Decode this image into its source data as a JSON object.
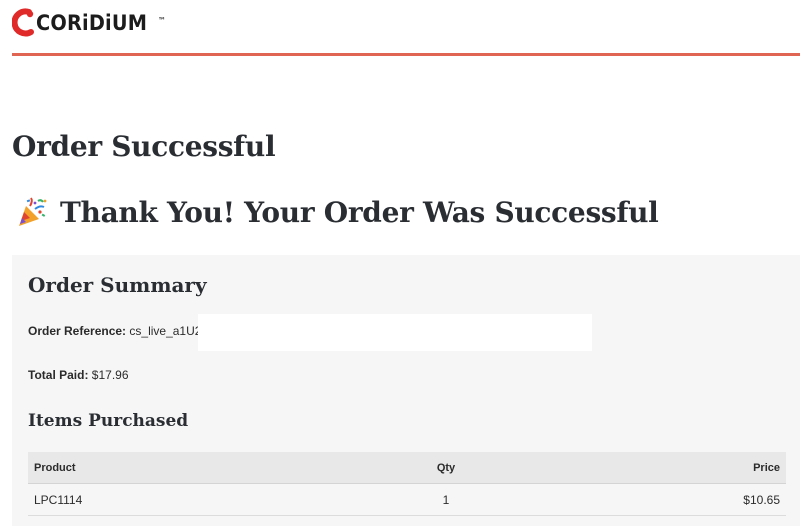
{
  "header": {
    "logo_text": "CORiDiUM",
    "logo_tm": "™",
    "logo_accent_color": "#e02a2a",
    "rule_color": "#e06553"
  },
  "page_title": "Order Successful",
  "thanks_heading": "Thank You! Your Order Was Successful",
  "thanks_icon": "party-popper-icon",
  "summary": {
    "title": "Order Summary",
    "reference_label": "Order Reference:",
    "reference_value": "cs_live_a1U2",
    "total_label": "Total Paid:",
    "total_value": "$17.96"
  },
  "items": {
    "title": "Items Purchased",
    "columns": [
      "Product",
      "Qty",
      "Price"
    ],
    "rows": [
      {
        "product": "LPC1114",
        "qty": "1",
        "price": "$10.65"
      }
    ]
  }
}
